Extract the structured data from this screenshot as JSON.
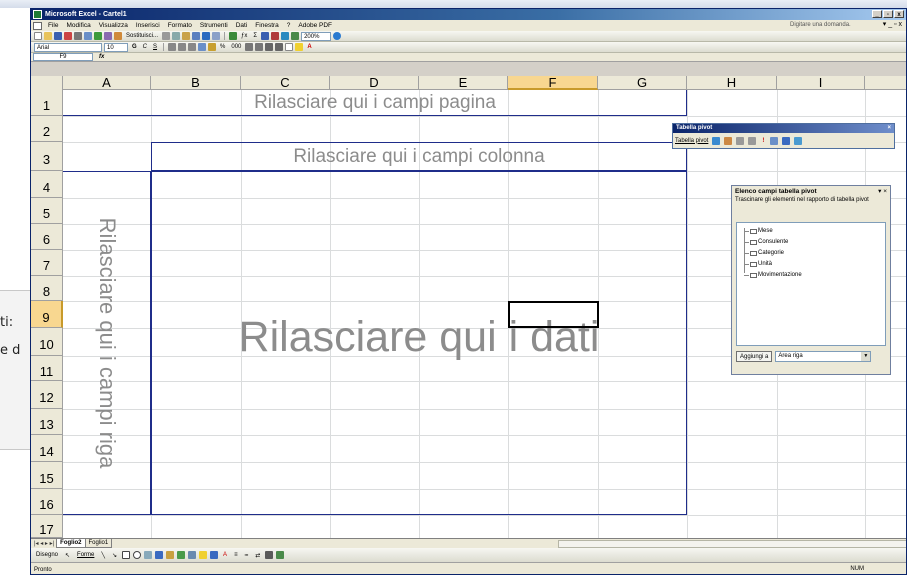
{
  "window": {
    "title": "Microsoft Excel - Cartel1"
  },
  "background_window": {
    "line1": "ti:",
    "line2": "e d"
  },
  "menu": {
    "items": [
      "File",
      "Modifica",
      "Visualizza",
      "Inserisci",
      "Formato",
      "Strumenti",
      "Dati",
      "Finestra",
      "?",
      "Adobe PDF"
    ],
    "help_placeholder": "Digitare una domanda."
  },
  "toolbar": {
    "replace_label": "Sostituisci...",
    "zoom": "200%",
    "font": "Arial",
    "font_size": "10"
  },
  "formula_bar": {
    "name_box": "F9",
    "fx": "fx"
  },
  "grid": {
    "columns": [
      "A",
      "B",
      "C",
      "D",
      "E",
      "F",
      "G",
      "H",
      "I"
    ],
    "rows": [
      "1",
      "2",
      "3",
      "4",
      "5",
      "6",
      "7",
      "8",
      "9",
      "10",
      "11",
      "12",
      "13",
      "14",
      "15",
      "16",
      "17"
    ],
    "selected_column": "F",
    "selected_row": "9"
  },
  "pivot": {
    "page_drop": "Rilasciare qui i campi pagina",
    "column_drop": "Rilasciare qui i campi colonna",
    "row_drop": "Rilasciare qui i campi riga",
    "data_drop": "Rilasciare qui i dati"
  },
  "pivot_toolbar": {
    "title": "Tabella pivot",
    "menu_label": "Tabella pivot",
    "close": "×"
  },
  "field_list": {
    "title": "Elenco campi tabella pivot",
    "hint": "Trascinare gli elementi nel rapporto di tabella pivot",
    "fields": [
      "Mese",
      "Consulente",
      "Categorie",
      "Unità",
      "Movimentazione"
    ],
    "add_button": "Aggiungi a",
    "area_select": "Area riga"
  },
  "sheets": {
    "tabs": [
      "Foglio2",
      "Foglio1"
    ],
    "active": "Foglio2"
  },
  "drawing_bar": {
    "draw_label": "Disegno",
    "shapes_label": "Forme"
  },
  "status": {
    "left": "Pronto",
    "right": "NUM"
  },
  "colors": {
    "accent": "#1f2d8a",
    "selection": "#f8d790",
    "drop_text": "#8c8c8c"
  }
}
